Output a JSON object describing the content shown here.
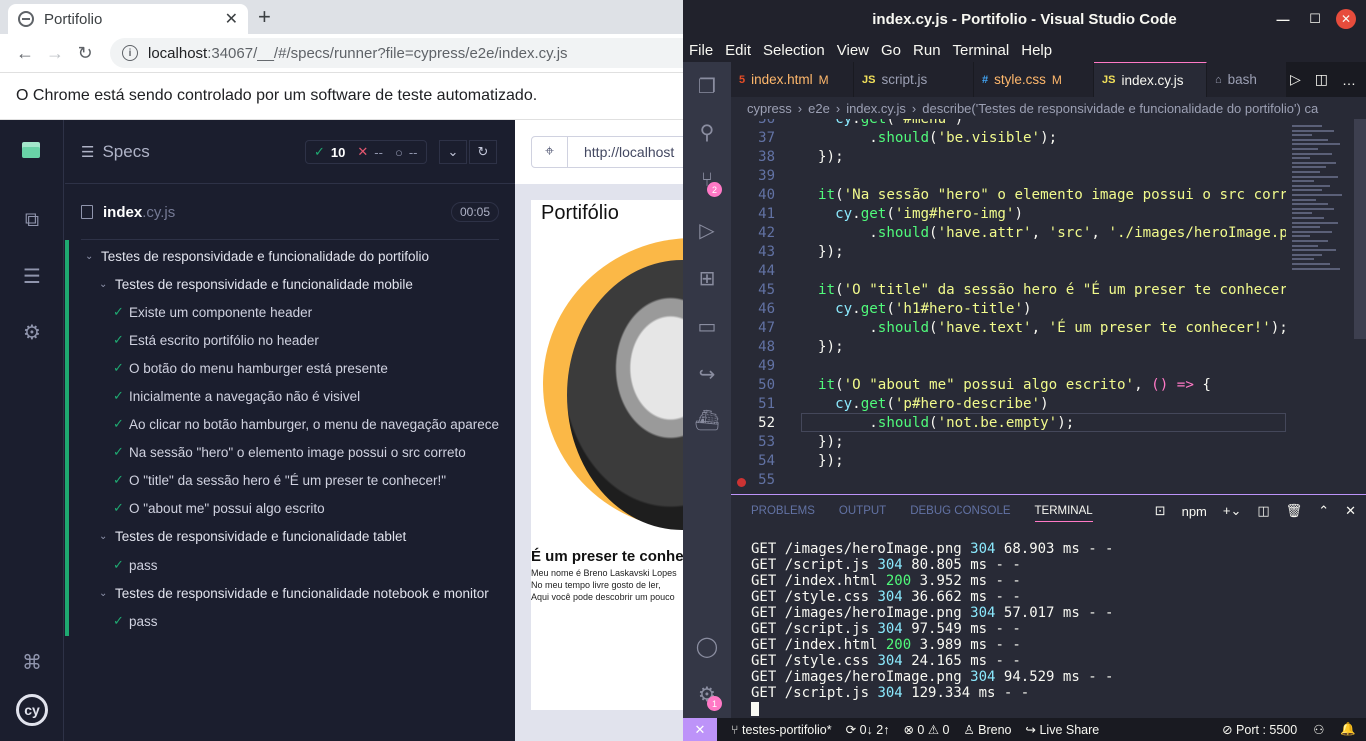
{
  "chrome": {
    "tab_title": "Portifolio",
    "url_host": "localhost",
    "url_path": ":34067/__/#/specs/runner?file=cypress/e2e/index.cy.js",
    "infobar_text": "O Chrome está sendo controlado por um software de teste automatizado."
  },
  "cypress": {
    "specs_label": "Specs",
    "passed_count": "10",
    "failed_count": "--",
    "pending_count": "--",
    "spec_name": "index",
    "spec_ext": ".cy.js",
    "duration": "00:05",
    "tests": [
      {
        "label": "Testes de responsividade e funcionalidade do portifolio",
        "kind": "suite"
      },
      {
        "label": "Testes de responsividade e funcionalidade mobile",
        "kind": "suite"
      },
      {
        "label": "Existe um componente header",
        "kind": "test"
      },
      {
        "label": "Está escrito portifólio no header",
        "kind": "test"
      },
      {
        "label": "O botão do menu hamburger está presente",
        "kind": "test"
      },
      {
        "label": "Inicialmente a navegação não é visivel",
        "kind": "test"
      },
      {
        "label": "Ao clicar no botão hamburger, o menu de navegação aparece",
        "kind": "test"
      },
      {
        "label": "Na sessão \"hero\" o elemento image possui o src correto",
        "kind": "test"
      },
      {
        "label": "O \"title\" da sessão hero é \"É um preser te conhecer!\"",
        "kind": "test"
      },
      {
        "label": "O \"about me\" possui algo escrito",
        "kind": "test"
      },
      {
        "label": "Testes de responsividade e funcionalidade tablet",
        "kind": "suite"
      },
      {
        "label": "pass",
        "kind": "test"
      },
      {
        "label": "Testes de responsividade e funcionalidade notebook e monitor",
        "kind": "suite"
      },
      {
        "label": "pass",
        "kind": "test"
      }
    ],
    "aut_url": "http://localhost",
    "aut_page": {
      "title": "Portifólio",
      "hero_title": "É um preser te conhecer!",
      "hero_lines": [
        "Meu nome é Breno Laskavski Lopes",
        "No meu tempo livre gosto de ler,",
        "Aqui você pode descobrir um pouco"
      ]
    }
  },
  "vscode": {
    "window_title": "index.cy.js - Portifolio - Visual Studio Code",
    "menu": [
      "File",
      "Edit",
      "Selection",
      "View",
      "Go",
      "Run",
      "Terminal",
      "Help"
    ],
    "tabs": [
      {
        "icon": "5",
        "label": "index.html",
        "mod": "M",
        "color": "#e44d26"
      },
      {
        "icon": "JS",
        "label": "script.js",
        "mod": "",
        "color": "#f1e05a"
      },
      {
        "icon": "#",
        "label": "style.css",
        "mod": "M",
        "color": "#42a5f5"
      },
      {
        "icon": "JS",
        "label": "index.cy.js",
        "mod": "",
        "color": "#f1e05a"
      },
      {
        "icon": "⌂",
        "label": "bash",
        "mod": "",
        "color": "#9ca0b4"
      }
    ],
    "breadcrumb": [
      "cypress",
      "e2e",
      "index.cy.js",
      "describe('Testes de responsividade e funcionalidade do portifolio') ca"
    ],
    "source_control_badge": "2",
    "settings_badge": "1",
    "code_lines": [
      {
        "n": "36",
        "html": "<span class='v'>  cy</span>.<span class='f'>get</span>(<span class='s'>'#menu'</span>)"
      },
      {
        "n": "37",
        "html": "<span class='p'>      .</span><span class='f'>should</span>(<span class='s'>'be.visible'</span>);"
      },
      {
        "n": "38",
        "html": "});"
      },
      {
        "n": "39",
        "html": ""
      },
      {
        "n": "40",
        "html": "<span class='f'>it</span>(<span class='s'>'Na sessão \"hero\" o elemento image possui o src correto'</span>"
      },
      {
        "n": "41",
        "html": "<span class='v'>  cy</span>.<span class='f'>get</span>(<span class='s'>'img#hero-img'</span>)"
      },
      {
        "n": "42",
        "html": "<span class='p'>      .</span><span class='f'>should</span>(<span class='s'>'have.attr'</span>, <span class='s'>'src'</span>, <span class='s'>'./images/heroImage.png'</span>"
      },
      {
        "n": "43",
        "html": "});"
      },
      {
        "n": "44",
        "html": ""
      },
      {
        "n": "45",
        "html": "<span class='f'>it</span>(<span class='s'>'O \"title\" da sessão hero é \"É um preser te conhecer!\"'</span>"
      },
      {
        "n": "46",
        "html": "<span class='v'>  cy</span>.<span class='f'>get</span>(<span class='s'>'h1#hero-title'</span>)"
      },
      {
        "n": "47",
        "html": "<span class='p'>      .</span><span class='f'>should</span>(<span class='s'>'have.text'</span>, <span class='s'>'É um preser te conhecer!'</span>);"
      },
      {
        "n": "48",
        "html": "});"
      },
      {
        "n": "49",
        "html": ""
      },
      {
        "n": "50",
        "html": "<span class='f'>it</span>(<span class='s'>'O \"about me\" possui algo escrito'</span>, <span class='o'>()</span> <span class='k'>=&gt;</span> {"
      },
      {
        "n": "51",
        "html": "<span class='v'>  cy</span>.<span class='f'>get</span>(<span class='s'>'p#hero-describe'</span>)"
      },
      {
        "n": "52",
        "html": "<span class='p'>      .</span><span class='f'>should</span>(<span class='s'>'not.be.empty'</span>);"
      },
      {
        "n": "53",
        "html": "});"
      },
      {
        "n": "54",
        "html": "});"
      },
      {
        "n": "55",
        "html": ""
      }
    ],
    "panel_tabs": [
      "PROBLEMS",
      "OUTPUT",
      "DEBUG CONSOLE",
      "TERMINAL"
    ],
    "terminal_shell": "npm",
    "terminal_lines": [
      {
        "path": "/images/heroImage.png",
        "status": "304",
        "time": "68.903"
      },
      {
        "path": "/script.js",
        "status": "304",
        "time": "80.805"
      },
      {
        "path": "/index.html",
        "status": "200",
        "time": "3.952"
      },
      {
        "path": "/style.css",
        "status": "304",
        "time": "36.662"
      },
      {
        "path": "/images/heroImage.png",
        "status": "304",
        "time": "57.017"
      },
      {
        "path": "/script.js",
        "status": "304",
        "time": "97.549"
      },
      {
        "path": "/index.html",
        "status": "200",
        "time": "3.989"
      },
      {
        "path": "/style.css",
        "status": "304",
        "time": "24.165"
      },
      {
        "path": "/images/heroImage.png",
        "status": "304",
        "time": "94.529"
      },
      {
        "path": "/script.js",
        "status": "304",
        "time": "129.334"
      }
    ],
    "status": {
      "branch": "testes-portifolio*",
      "sync": "0↓ 2↑",
      "errors": "0",
      "warnings": "0",
      "user": "Breno",
      "live_share": "Live Share",
      "port": "Port : 5500"
    }
  }
}
